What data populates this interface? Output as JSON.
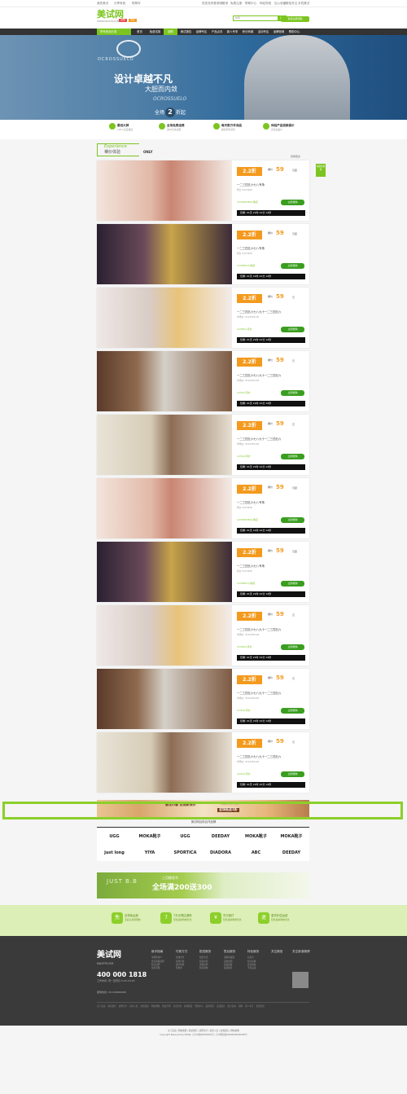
{
  "topbar": {
    "left": [
      "我的美试",
      "分享有奖",
      "购物车"
    ],
    "right": [
      "您还没有登录哦!",
      "登录",
      "免费注册",
      "帮助中心",
      "网站导航",
      "加入收藏",
      "微信关注",
      "手机美试"
    ]
  },
  "header": {
    "logo": "美试网",
    "logo_sub": "WWW.MAXTP.COM",
    "tag1": "团购",
    "tag2": "特卖",
    "search_placeholder": "搜索",
    "search_button": "搜索",
    "register_button": "免费注册领取"
  },
  "nav": {
    "category": "所有商品分类",
    "items": [
      "首页",
      "免费试用",
      "团购",
      "美试报告",
      "品牌专区",
      "产品点评",
      "新人专享",
      "积分商城",
      "活动专区",
      "品牌官网",
      "帮助中心"
    ],
    "active_index": 2
  },
  "banner": {
    "brand": "OCROSSUELO",
    "line1": "设计卓越不凡",
    "line2": "大胆而内敛",
    "line3": "OCROSSUELO",
    "line4_pre": "全场",
    "line4_num": "2",
    "line4_post": "折起"
  },
  "features": [
    {
      "title": "最低大牌",
      "sub": "100%正品保证"
    },
    {
      "title": "全场免费运费",
      "sub": "满99元免运费"
    },
    {
      "title": "每天数万件商品",
      "sub": "超值折扣疯抢"
    },
    {
      "title": "体验产品退款保价",
      "sub": "买贵退差价"
    }
  ],
  "experience": {
    "en": "Experience",
    "cn": "裸价体验",
    "brand": "ONLY",
    "more": "查看更多",
    "side_tag": "领取优惠券"
  },
  "deals": [
    {
      "discount": "2.2折",
      "price_label": "裸价",
      "price": "59",
      "unit": "元起",
      "title": "一二三四五六七八专场",
      "orig": "原价 ¥123456",
      "sold": "123456789人购买",
      "button": "立即抢购",
      "timer": "仅剩: 01天 21时 22分 12秒"
    },
    {
      "discount": "2.2折",
      "price_label": "裸价",
      "price": "59",
      "unit": "元起",
      "title": "一二三四五六七八专场",
      "orig": "原价 ¥123456",
      "sold": "1234567人购买",
      "button": "立即抢购",
      "timer": "仅剩: 01天 21时 22分 12秒"
    },
    {
      "discount": "2.2折",
      "price_label": "裸价",
      "price": "59",
      "unit": "元",
      "title": "一二三四五六七八九十一二三四五六",
      "orig": "市场价: ¥123456.00",
      "sold": "12345人评价",
      "button": "立即抢购",
      "timer": "仅剩: 01天 21时 22分 12秒"
    },
    {
      "discount": "2.2折",
      "price_label": "裸价",
      "price": "59",
      "unit": "元",
      "title": "一二三四五六七八九十一二三四五六",
      "orig": "市场价: ¥123456.00",
      "sold": "1234人评价",
      "button": "立即抢购",
      "timer": "仅剩: 01天 21时 22分 12秒"
    },
    {
      "discount": "2.2折",
      "price_label": "裸价",
      "price": "59",
      "unit": "元",
      "title": "一二三四五六七八九十一二三四五六",
      "orig": "市场价: ¥123456.00",
      "sold": "1234人评价",
      "button": "立即抢购",
      "timer": "仅剩: 01天 21时 22分 12秒"
    },
    {
      "discount": "2.2折",
      "price_label": "裸价",
      "price": "59",
      "unit": "元起",
      "title": "一二三四五六七八专场",
      "orig": "原价 ¥123456",
      "sold": "123456789人购买",
      "button": "立即抢购",
      "timer": "仅剩: 01天 21时 22分 12秒"
    },
    {
      "discount": "2.2折",
      "price_label": "裸价",
      "price": "59",
      "unit": "元起",
      "title": "一二三四五六七八专场",
      "orig": "原价 ¥123456",
      "sold": "1234567人购买",
      "button": "立即抢购",
      "timer": "仅剩: 01天 21时 22分 12秒"
    },
    {
      "discount": "2.2折",
      "price_label": "裸价",
      "price": "59",
      "unit": "元",
      "title": "一二三四五六七八九十一二三四五六",
      "orig": "市场价: ¥123456.00",
      "sold": "12345人评价",
      "button": "立即抢购",
      "timer": "仅剩: 01天 21时 22分 12秒"
    },
    {
      "discount": "2.2折",
      "price_label": "裸价",
      "price": "59",
      "unit": "元",
      "title": "一二三四五六七八九十一二三四五六",
      "orig": "市场价: ¥123456.00",
      "sold": "1234人评价",
      "button": "立即抢购",
      "timer": "仅剩: 01天 21时 22分 12秒"
    },
    {
      "discount": "2.2折",
      "price_label": "裸价",
      "price": "59",
      "unit": "元",
      "title": "一二三四五六七八九十一二三四五六",
      "orig": "市场价: ¥123456.00",
      "sold": "1234人评价",
      "button": "立即抢购",
      "timer": "仅剩: 01天 21时 22分 12秒"
    }
  ],
  "ad1": {
    "left": "繁花の春 发现新饰界",
    "middle": "全场低至1折",
    "tiny": "精品首饰 春季特惠"
  },
  "brands": {
    "title": "美试网目前合作品牌",
    "row1": [
      "UGG",
      "MOKA靴子",
      "UGG",
      "DEEDAY",
      "MOKA靴子",
      "MOKA靴子"
    ],
    "row2": [
      "just long",
      "YIYA",
      "SPORTICA",
      "DIADORA",
      "ABC",
      "DEEDAY"
    ]
  },
  "ad2": {
    "left": "JUST B.B",
    "top": "三月桃花节",
    "main": "全场满200送300"
  },
  "guarantee": [
    {
      "icon": "免",
      "title": "全场免运费",
      "sub": "无最高消费限制"
    },
    {
      "icon": "7",
      "title": "7天无理由退换",
      "sub": "轻松退换购物无忧"
    },
    {
      "icon": "¥",
      "title": "先行赔付",
      "sub": "轻松退换购物无忧"
    },
    {
      "icon": "退",
      "title": "退货补偿运费",
      "sub": "轻松退换购物无忧"
    }
  ],
  "footer": {
    "logo": "美试网",
    "sub": "MAXTP.COM",
    "phone": "400 000 1818",
    "hours": "工作时间: 周一至周日 9:00-18:00",
    "email": "团购热线: 010-66666666",
    "cols": [
      {
        "head": "新手指南",
        "links": [
          "注册新用户",
          "会员等级说明",
          "积分说明",
          "常见问题"
        ]
      },
      {
        "head": "付款方式",
        "links": [
          "在线支付",
          "货到付款",
          "银行转账",
          "优惠券"
        ]
      },
      {
        "head": "配送服务",
        "links": [
          "配送方式",
          "配送时间",
          "运费说明",
          "验货签收"
        ]
      },
      {
        "head": "售后服务",
        "links": [
          "退换货政策",
          "退款说明",
          "商品质量",
          "投诉建议"
        ]
      },
      {
        "head": "特色服务",
        "links": [
          "礼品卡",
          "积分商城",
          "会员特权",
          "手机美试"
        ]
      },
      {
        "head": "关注微信",
        "links": []
      },
      {
        "head": "关注新浪微博",
        "links": []
      }
    ],
    "links": [
      "关于美试",
      "联系我们",
      "诚聘英才",
      "商家入驻",
      "友情链接",
      "网站地图",
      "隐私声明",
      "免责条款",
      "媒体报道",
      "帮助中心",
      "品牌专区",
      "美试报告",
      "积分商城",
      "团购",
      "新人专享",
      "免费试用"
    ],
    "copyright": [
      "关于美试 | 网站联盟 | 联系我们 | 诚聘英才 | 商家入驻 | 友情链接 | 网站地图",
      "Copyright Reserved by MaXtp | 京ICP备00000000号 | 京公网安备00000000000000号"
    ]
  }
}
